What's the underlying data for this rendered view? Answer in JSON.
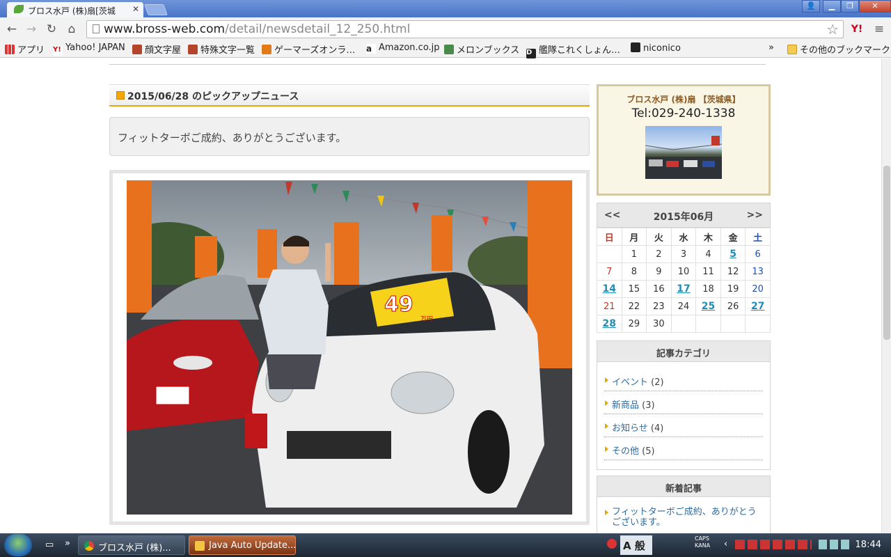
{
  "browser": {
    "tab_title": "ブロス水戸 (株)扇[茨城",
    "url_domain": "www.bross-web.com",
    "url_path": "/detail/newsdetail_12_250.html",
    "bookmarks": [
      "アプリ",
      "Yahoo! JAPAN",
      "顔文字屋",
      "特殊文字一覧",
      "ゲーマーズオンラ…",
      "Amazon.co.jp",
      "メロンブックス",
      "艦隊これくしょん…",
      "niconico"
    ],
    "bookmarks_overflow": "»",
    "other_bookmarks": "その他のブックマーク"
  },
  "news": {
    "heading": "2015/06/28 のピックアップニュース",
    "title": "フィットターボご成約、ありがとうございます。",
    "photo_price": "49",
    "photo_price_unit": "万円"
  },
  "shop": {
    "name": "ブロス水戸 (株)扇 【茨城県】",
    "tel": "Tel:029-240-1338"
  },
  "calendar": {
    "prev": "<<",
    "next": ">>",
    "title": "2015年06月",
    "weekdays": [
      "日",
      "月",
      "火",
      "水",
      "木",
      "金",
      "土"
    ],
    "weeks": [
      [
        "",
        "1",
        "2",
        "3",
        "4",
        "5",
        "6"
      ],
      [
        "7",
        "8",
        "9",
        "10",
        "11",
        "12",
        "13"
      ],
      [
        "14",
        "15",
        "16",
        "17",
        "18",
        "19",
        "20"
      ],
      [
        "21",
        "22",
        "23",
        "24",
        "25",
        "26",
        "27"
      ],
      [
        "28",
        "29",
        "30",
        "",
        "",
        "",
        ""
      ]
    ],
    "linked_days": [
      "5",
      "14",
      "17",
      "25",
      "27",
      "28"
    ]
  },
  "categories": {
    "heading": "記事カテゴリ",
    "items": [
      {
        "label": "イベント",
        "count": "(2)"
      },
      {
        "label": "新商品",
        "count": "(3)"
      },
      {
        "label": "お知らせ",
        "count": "(4)"
      },
      {
        "label": "その他",
        "count": "(5)"
      }
    ]
  },
  "recent": {
    "heading": "新着記事",
    "items": [
      {
        "label": "フィットターボご成約、ありがとうございます。"
      }
    ]
  },
  "taskbar": {
    "tasks": [
      "ブロス水戸 (株)...",
      "Java Auto Update..."
    ],
    "caps": "CAPS",
    "kana": "KANA",
    "ime": "般",
    "clock": "18:44"
  },
  "colors": {
    "accent": "#e5a800",
    "link": "#2c6a9e",
    "calendar_link": "#1f8db8",
    "sunday": "#c0392b",
    "saturday": "#1f4fae"
  }
}
